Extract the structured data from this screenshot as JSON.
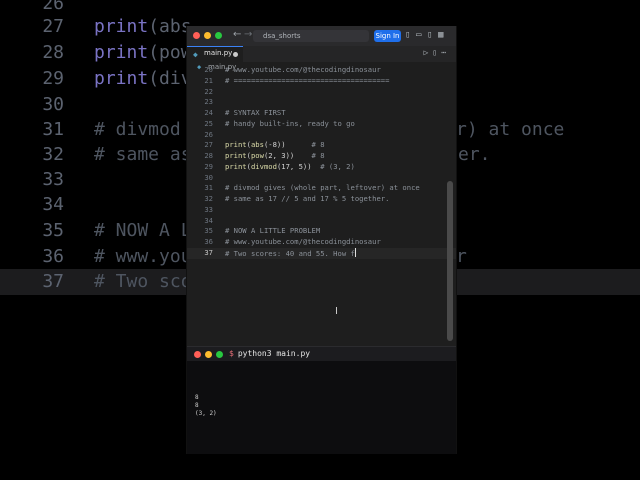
{
  "background": {
    "lines": [
      {
        "ln": "26",
        "text": ""
      },
      {
        "ln": "27",
        "fn": "print",
        "text": "(abs"
      },
      {
        "ln": "28",
        "fn": "print",
        "text": "(pow"
      },
      {
        "ln": "29",
        "fn": "print",
        "text": "(div"
      },
      {
        "ln": "30",
        "text": ""
      },
      {
        "ln": "31",
        "text": ""
      },
      {
        "ln": "32",
        "text": ""
      },
      {
        "ln": "33",
        "text": ""
      },
      {
        "ln": "34",
        "text": ""
      },
      {
        "ln": "35",
        "text": ""
      },
      {
        "ln": "36",
        "text": ""
      },
      {
        "ln": "37",
        "text": ""
      }
    ],
    "line31": "# divmod",
    "line31_right": "r) at once",
    "line32": "# same as",
    "line32_right": "er.",
    "line35": "# NOW A L",
    "line36": "# www.you",
    "line36_right": "r",
    "line37": "# Two sco"
  },
  "window": {
    "title": "dsa_shorts",
    "sign_in": "Sign In",
    "colors": {
      "close": "#ff5f57",
      "min": "#febc2e",
      "max": "#28c840",
      "accent": "#1f6feb"
    }
  },
  "tab": {
    "filename": "main.py"
  },
  "breadcrumb": {
    "filename": "main.py"
  },
  "editor": {
    "lines": [
      {
        "ln": "20",
        "text": "# www.youtube.com/@thecodingdinosaur",
        "kind": "cm"
      },
      {
        "ln": "21",
        "text": "# ====================================",
        "kind": "cm"
      },
      {
        "ln": "22",
        "text": "",
        "kind": "plain"
      },
      {
        "ln": "23",
        "text": "",
        "kind": "plain"
      },
      {
        "ln": "24",
        "text": "# SYNTAX FIRST",
        "kind": "cm"
      },
      {
        "ln": "25",
        "text": "# handy built-ins, ready to go",
        "kind": "cm"
      },
      {
        "ln": "26",
        "text": "",
        "kind": "plain"
      },
      {
        "ln": "27",
        "fn": "print",
        "inner_fn": "abs",
        "args": "(-8))",
        "comment": "      # 8",
        "kind": "call1"
      },
      {
        "ln": "28",
        "fn": "print",
        "inner_fn": "pow",
        "args": "(2, 3))",
        "comment": "    # 8",
        "kind": "call1"
      },
      {
        "ln": "29",
        "fn": "print",
        "inner_fn": "divmod",
        "args": "(17, 5))",
        "comment": "  # (3, 2)",
        "kind": "call1"
      },
      {
        "ln": "30",
        "text": "",
        "kind": "plain"
      },
      {
        "ln": "31",
        "text": "# divmod gives (whole part, leftover) at once",
        "kind": "cm"
      },
      {
        "ln": "32",
        "text": "# same as 17 // 5 and 17 % 5 together.",
        "kind": "cm"
      },
      {
        "ln": "33",
        "text": "",
        "kind": "plain"
      },
      {
        "ln": "34",
        "text": "",
        "kind": "plain"
      },
      {
        "ln": "35",
        "text": "# NOW A LITTLE PROBLEM",
        "kind": "cm"
      },
      {
        "ln": "36",
        "text": "# www.youtube.com/@thecodingdinosaur",
        "kind": "cm"
      },
      {
        "ln": "37",
        "text": "# Two scores: 40 and 55. How f",
        "kind": "cm",
        "current": true
      }
    ]
  },
  "terminal": {
    "command": "python3 main.py",
    "prompt_symbol": "$",
    "output": [
      "8",
      "8",
      "(3, 2)"
    ]
  }
}
